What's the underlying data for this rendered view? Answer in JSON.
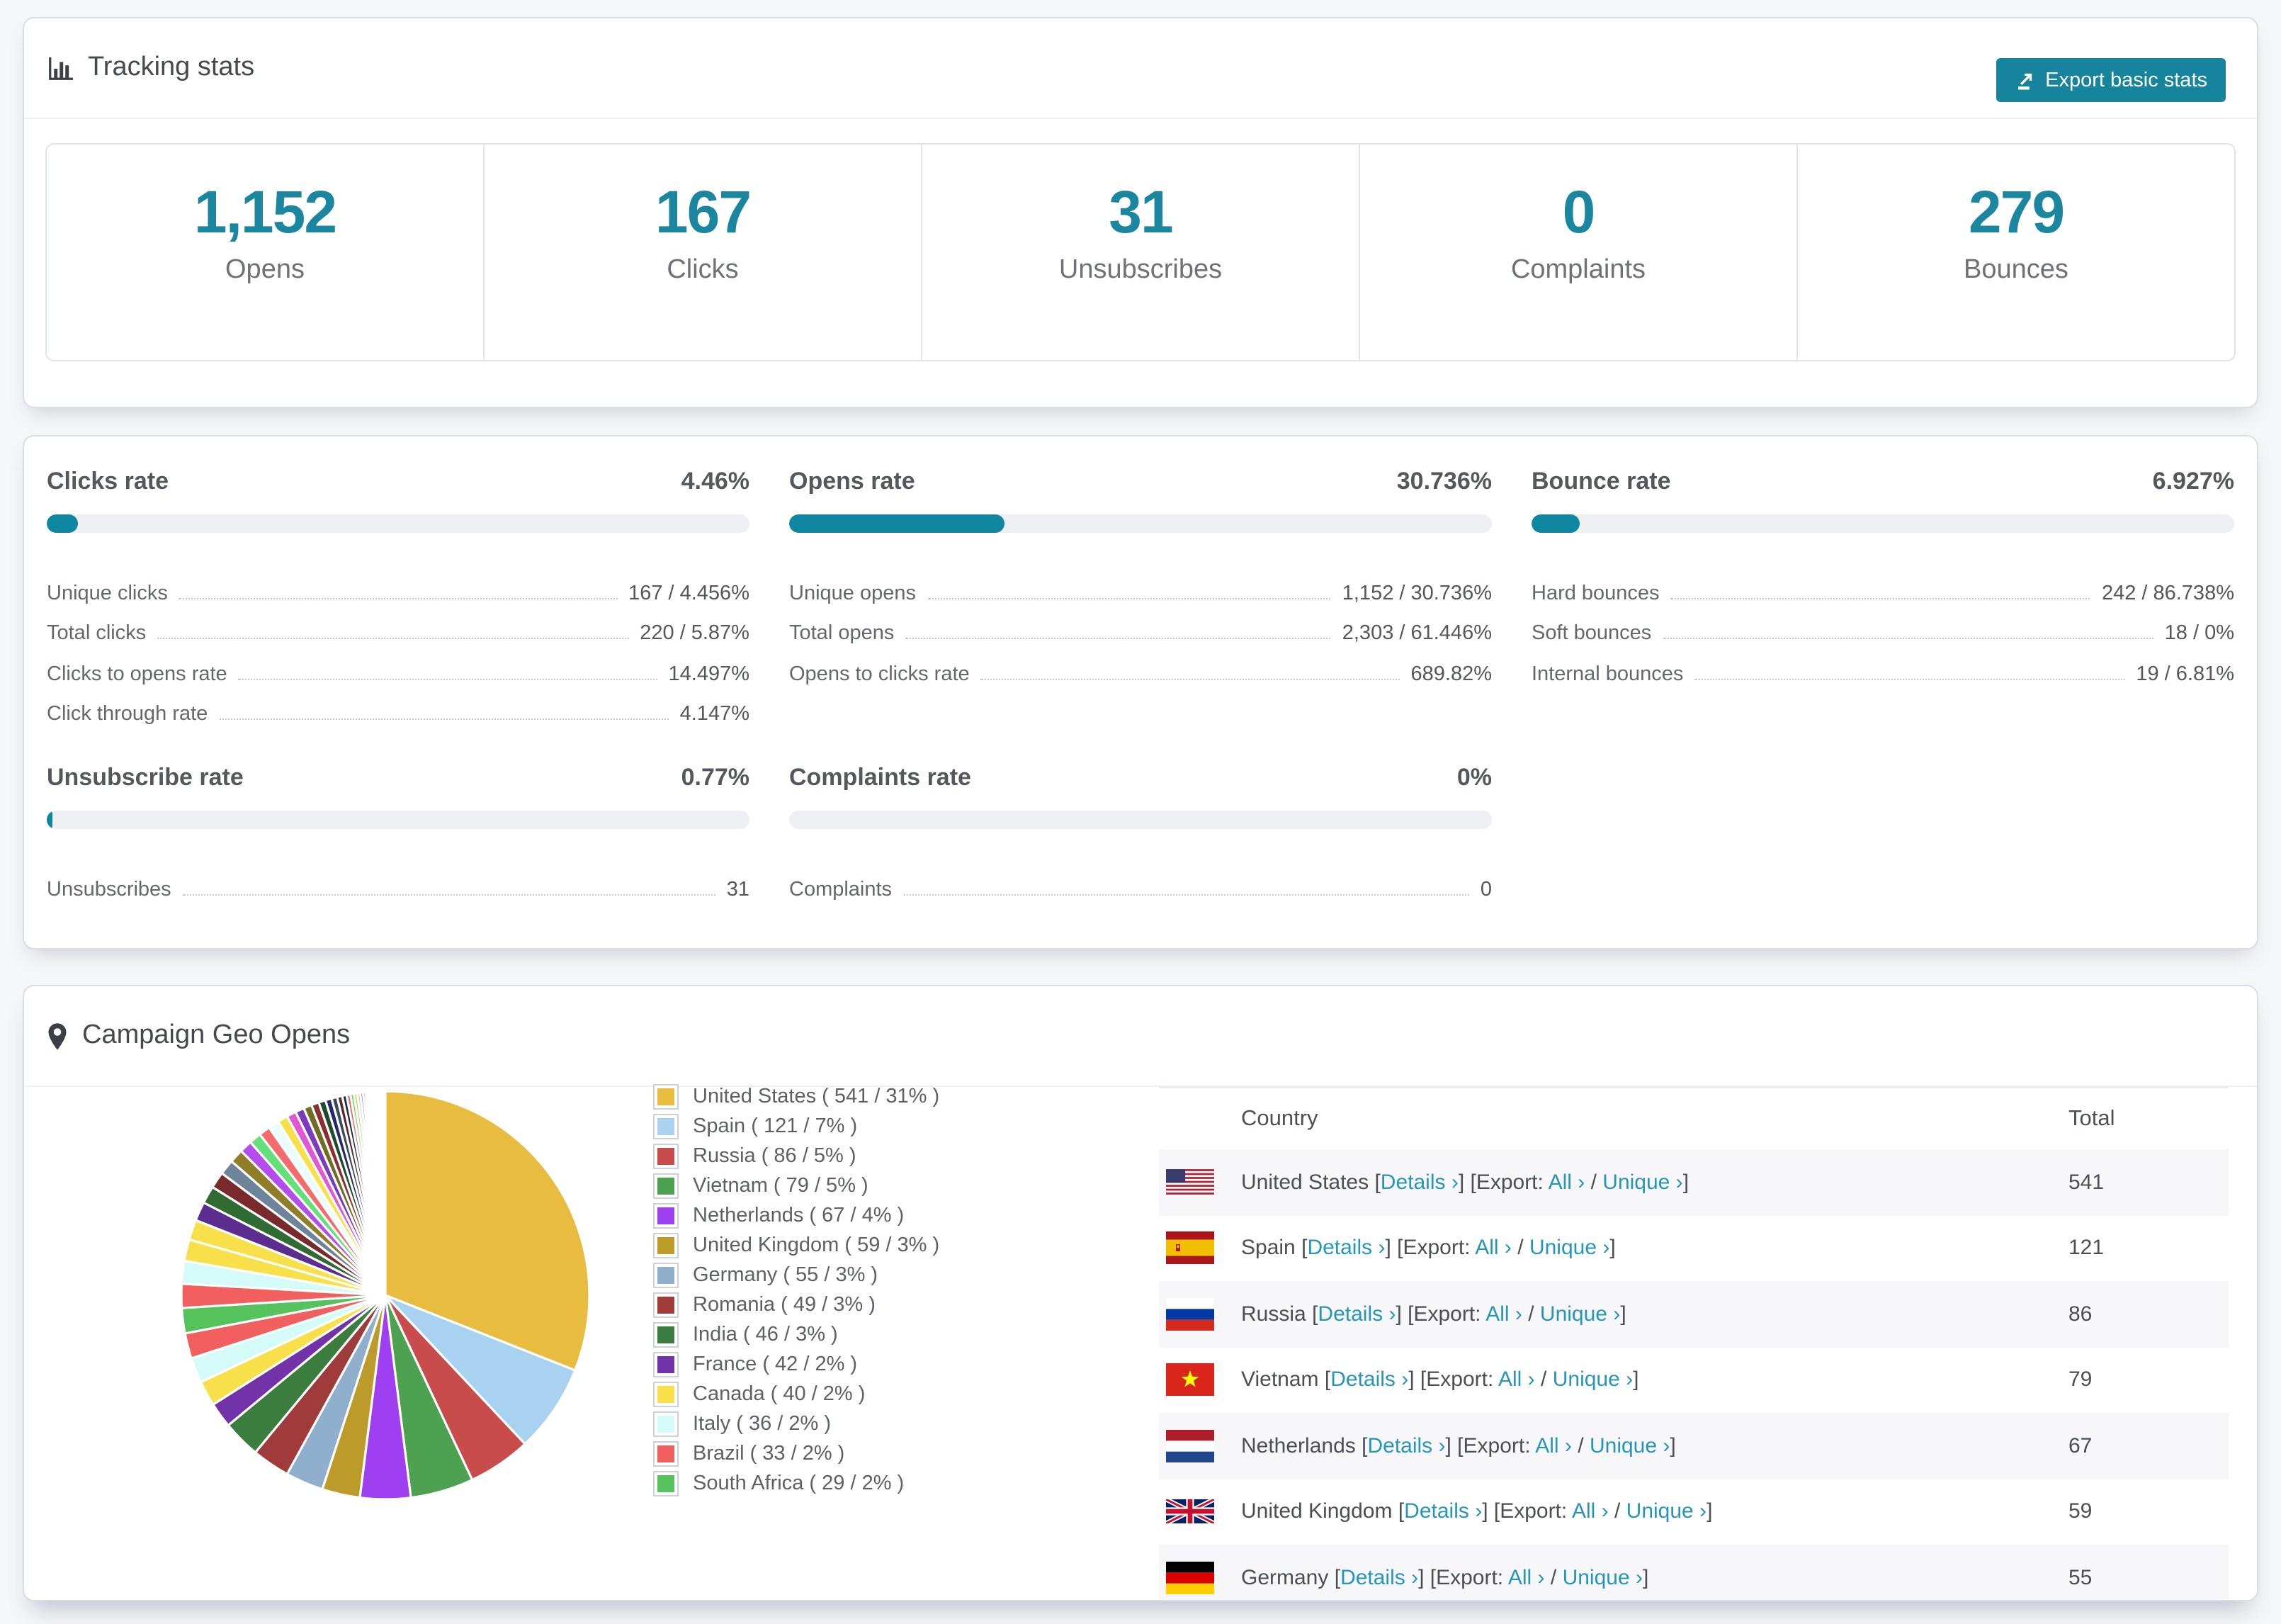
{
  "colors": {
    "accent_teal": "#16849c",
    "number_teal": "#1b86a0",
    "bar_fill": "#0f87a1",
    "bar_track": "#edeff3",
    "link_teal": "#2596b8",
    "page_bg": "#f5f6f8",
    "stripe": "#f7f7f9"
  },
  "tracking": {
    "title": "Tracking stats",
    "export_button": "Export basic stats",
    "stats": [
      {
        "value": "1,152",
        "label": "Opens"
      },
      {
        "value": "167",
        "label": "Clicks"
      },
      {
        "value": "31",
        "label": "Unsubscribes"
      },
      {
        "value": "0",
        "label": "Complaints"
      },
      {
        "value": "279",
        "label": "Bounces"
      }
    ]
  },
  "rates": {
    "blocks": [
      {
        "title": "Clicks rate",
        "value": "4.46%",
        "bar_pct": 4.46,
        "metrics": [
          {
            "label": "Unique clicks",
            "value": "167 / 4.456%"
          },
          {
            "label": "Total clicks",
            "value": "220 / 5.87%"
          },
          {
            "label": "Clicks to opens rate",
            "value": "14.497%"
          },
          {
            "label": "Click through rate",
            "value": "4.147%"
          }
        ]
      },
      {
        "title": "Opens rate",
        "value": "30.736%",
        "bar_pct": 30.736,
        "metrics": [
          {
            "label": "Unique opens",
            "value": "1,152 / 30.736%"
          },
          {
            "label": "Total opens",
            "value": "2,303 / 61.446%"
          },
          {
            "label": "Opens to clicks rate",
            "value": "689.82%"
          }
        ]
      },
      {
        "title": "Bounce rate",
        "value": "6.927%",
        "bar_pct": 6.927,
        "metrics": [
          {
            "label": "Hard bounces",
            "value": "242 / 86.738%"
          },
          {
            "label": "Soft bounces",
            "value": "18 / 0%"
          },
          {
            "label": "Internal bounces",
            "value": "19 / 6.81%"
          }
        ]
      },
      {
        "title": "Unsubscribe rate",
        "value": "0.77%",
        "bar_pct": 0.77,
        "metrics": [
          {
            "label": "Unsubscribes",
            "value": "31"
          }
        ]
      },
      {
        "title": "Complaints rate",
        "value": "0%",
        "bar_pct": 0,
        "metrics": [
          {
            "label": "Complaints",
            "value": "0"
          }
        ]
      }
    ]
  },
  "geo": {
    "title": "Campaign Geo Opens",
    "table": {
      "headers": [
        "Country",
        "Total"
      ],
      "link_labels": {
        "details": "Details ›",
        "export_prefix": "[Export:",
        "all": "All ›",
        "separator": "/",
        "unique": "Unique ›",
        "bracket_open": "[",
        "bracket_close": "]"
      },
      "rows": [
        {
          "country": "United States",
          "flag": "us",
          "total": "541"
        },
        {
          "country": "Spain",
          "flag": "es",
          "total": "121"
        },
        {
          "country": "Russia",
          "flag": "ru",
          "total": "86"
        },
        {
          "country": "Vietnam",
          "flag": "vn",
          "total": "79"
        },
        {
          "country": "Netherlands",
          "flag": "nl",
          "total": "67"
        },
        {
          "country": "United Kingdom",
          "flag": "gb",
          "total": "59"
        },
        {
          "country": "Germany",
          "flag": "de",
          "total": "55"
        }
      ]
    }
  },
  "chart_data": {
    "type": "pie",
    "title": "Campaign Geo Opens",
    "legend_position": "right",
    "start_angle_deg": 0,
    "direction": "clockwise",
    "legend_format": "name ( count / pct% )",
    "series": [
      {
        "name": "United States",
        "count": 541,
        "pct": 31,
        "color": "#e8bd3f"
      },
      {
        "name": "Spain",
        "count": 121,
        "pct": 7,
        "color": "#a8d2f0"
      },
      {
        "name": "Russia",
        "count": 86,
        "pct": 5,
        "color": "#c94c4c"
      },
      {
        "name": "Vietnam",
        "count": 79,
        "pct": 5,
        "color": "#4ea151"
      },
      {
        "name": "Netherlands",
        "count": 67,
        "pct": 4,
        "color": "#9e3ff2"
      },
      {
        "name": "United Kingdom",
        "count": 59,
        "pct": 3,
        "color": "#bd9b2a"
      },
      {
        "name": "Germany",
        "count": 55,
        "pct": 3,
        "color": "#8fafcc"
      },
      {
        "name": "Romania",
        "count": 49,
        "pct": 3,
        "color": "#a03b3b"
      },
      {
        "name": "India",
        "count": 46,
        "pct": 3,
        "color": "#3a7d3f"
      },
      {
        "name": "France",
        "count": 42,
        "pct": 2,
        "color": "#7233a8"
      },
      {
        "name": "Canada",
        "count": 40,
        "pct": 2,
        "color": "#f7e04a"
      },
      {
        "name": "Italy",
        "count": 36,
        "pct": 2,
        "color": "#d4fbf8"
      },
      {
        "name": "Brazil",
        "count": 33,
        "pct": 2,
        "color": "#f15f5f"
      },
      {
        "name": "South Africa",
        "count": 29,
        "pct": 2,
        "color": "#55c25c"
      }
    ],
    "others_unlabeled": {
      "pcts": [
        1.9,
        1.8,
        1.7,
        1.6,
        1.5,
        1.4,
        1.3,
        1.2,
        1.1,
        1.0,
        0.95,
        0.9,
        0.85,
        0.8,
        0.75,
        0.7,
        0.65,
        0.6,
        0.55,
        0.5,
        0.45,
        0.4,
        0.35,
        0.3,
        0.28,
        0.26,
        0.24,
        0.22,
        0.2,
        0.18,
        0.16,
        0.14,
        0.12,
        0.1,
        0.09,
        0.08,
        0.07,
        0.06,
        0.05,
        0.04
      ],
      "colors": [
        "#f15f5f",
        "#d4fbf8",
        "#f7e04a",
        "#f7e04a",
        "#5b2d8e",
        "#2f6b33",
        "#7a2a2a",
        "#6e8499",
        "#8f7d27",
        "#b44df0",
        "#63e078",
        "#f56b6b",
        "#eafdfb",
        "#f7e04a",
        "#e356d5",
        "#7a3bbf",
        "#6e6e22",
        "#8e2e2e",
        "#1e4d2e",
        "#27276b",
        "#374d5e",
        "#5e2727",
        "#163042",
        "#f15f5f",
        "#63db6b",
        "#e8bd3f",
        "#a8d2f0",
        "#c94c4c",
        "#4ea151",
        "#9e3ff2",
        "#bd9b2a",
        "#8fafcc",
        "#a03b3b",
        "#3a7d3f",
        "#7233a8",
        "#f7e04a",
        "#d4fbf8",
        "#f15f5f",
        "#55c25c",
        "#e356d5"
      ]
    }
  }
}
